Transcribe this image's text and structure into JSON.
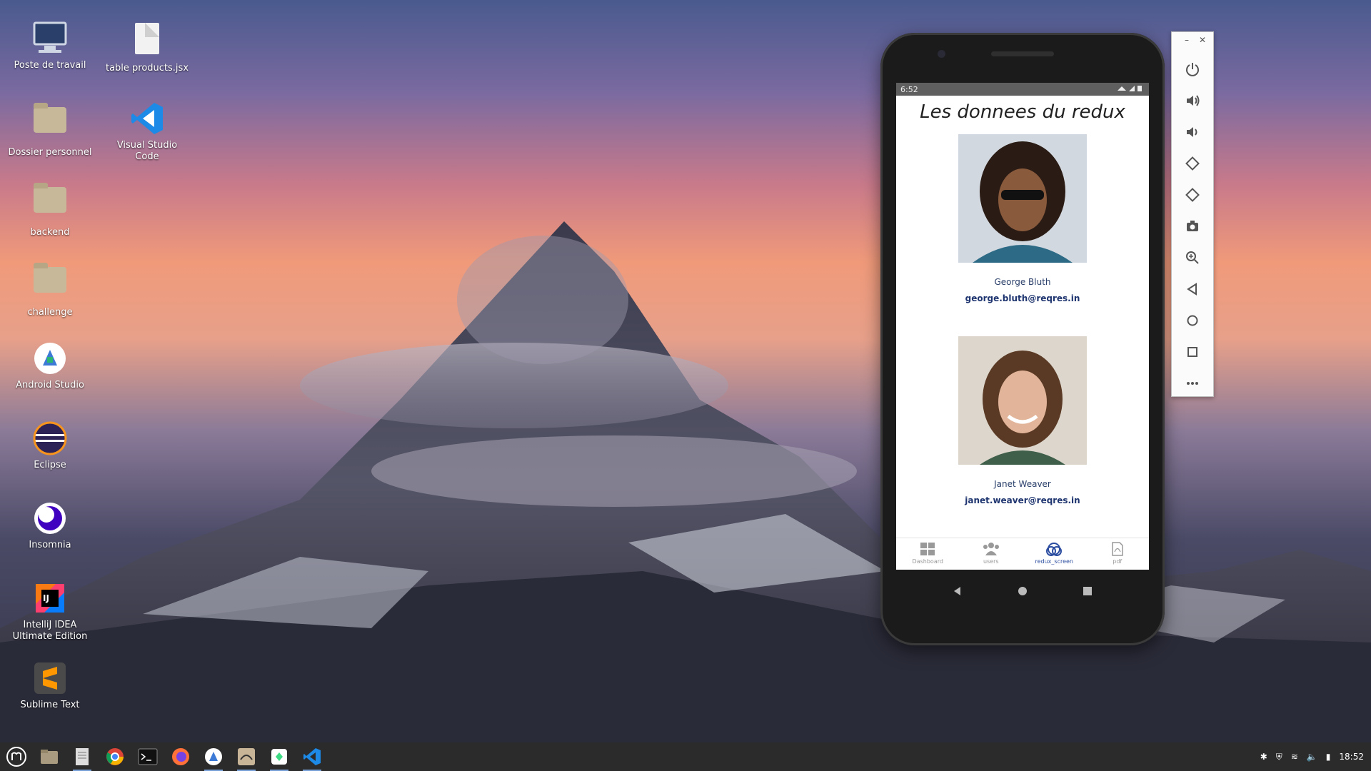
{
  "desktop": {
    "icons": [
      {
        "label": "Poste de travail",
        "icon": "computer-icon"
      },
      {
        "label": "table products.jsx",
        "icon": "file-icon"
      },
      {
        "label": "Dossier personnel",
        "icon": "home-folder-icon"
      },
      {
        "label": "Visual Studio Code",
        "icon": "vscode-icon"
      },
      {
        "label": "backend",
        "icon": "folder-icon"
      },
      {
        "label": "challenge",
        "icon": "folder-icon"
      },
      {
        "label": "Android Studio",
        "icon": "android-studio-icon"
      },
      {
        "label": "Eclipse",
        "icon": "eclipse-icon"
      },
      {
        "label": "Insomnia",
        "icon": "insomnia-icon"
      },
      {
        "label": "IntelliJ IDEA Ultimate Edition",
        "icon": "intellij-icon"
      },
      {
        "label": "Sublime Text",
        "icon": "sublime-icon"
      }
    ]
  },
  "phone": {
    "status_time": "6:52",
    "app_title": "Les donnees du redux",
    "users": [
      {
        "name": "George Bluth",
        "email": "george.bluth@reqres.in"
      },
      {
        "name": "Janet Weaver",
        "email": "janet.weaver@reqres.in"
      }
    ],
    "bottom_nav": [
      {
        "label": "Dashboard",
        "icon": "dashboard-icon",
        "active": false
      },
      {
        "label": "users",
        "icon": "users-icon",
        "active": false
      },
      {
        "label": "redux_screen",
        "icon": "redux-icon",
        "active": true
      },
      {
        "label": "pdf",
        "icon": "pdf-icon",
        "active": false
      }
    ]
  },
  "emulator_toolbar": {
    "buttons": [
      "power-icon",
      "volume-up-icon",
      "volume-down-icon",
      "rotate-left-icon",
      "rotate-right-icon",
      "camera-icon",
      "zoom-icon",
      "back-icon",
      "home-icon",
      "overview-icon",
      "more-icon"
    ]
  },
  "taskbar": {
    "clock": "18:52",
    "apps": [
      "mint-menu-icon",
      "files-icon",
      "text-editor-icon",
      "chrome-icon",
      "terminal-icon",
      "firefox-icon",
      "android-studio-icon",
      "android-studio-icon",
      "emulator-icon",
      "vscode-icon"
    ]
  },
  "colors": {
    "accent": "#2d4ea0",
    "nav_inactive": "#999999",
    "taskbar": "#2b2b2b"
  }
}
